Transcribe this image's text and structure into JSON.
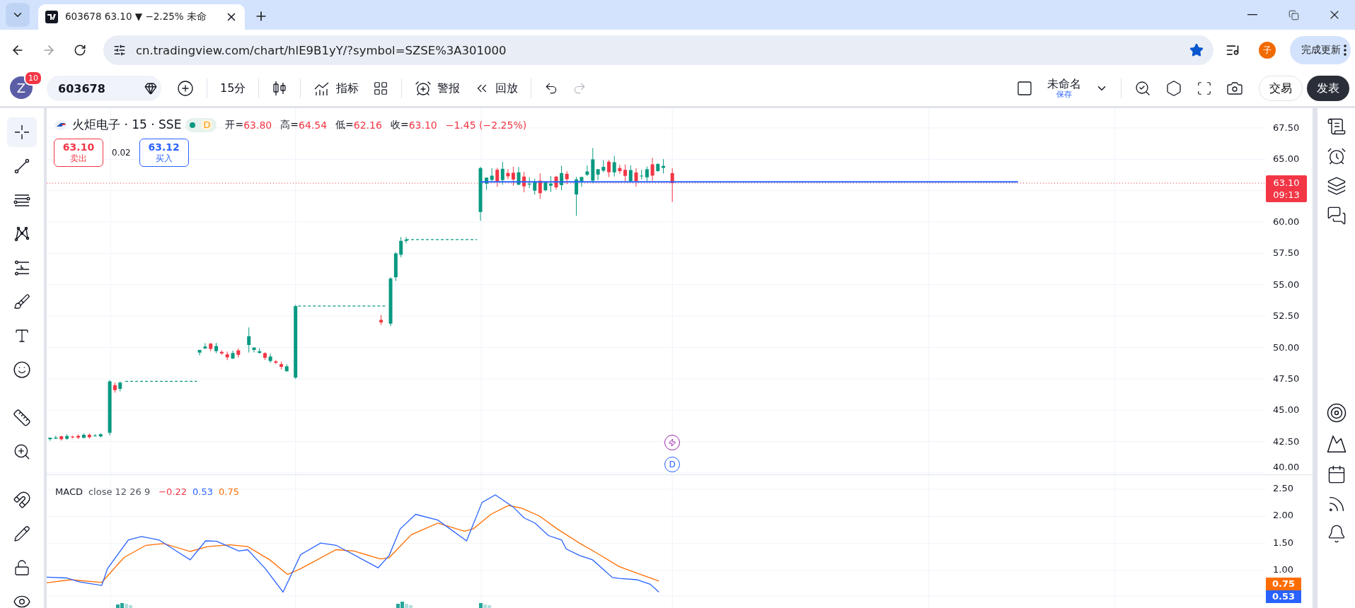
{
  "browser": {
    "tab_title": "603678 63.10 ▼ −2.25% 未命",
    "url": "cn.tradingview.com/chart/hlE9B1yY/?symbol=SZSE%3A301000",
    "profile_initial": "子",
    "update_button": "完成更新"
  },
  "toolbar": {
    "avatar": "Z",
    "notifications": "10",
    "symbol": "603678",
    "interval": "15分",
    "indicators": "指标",
    "alert": "警报",
    "replay": "回放",
    "layout_name": "未命名",
    "save_status": "保存",
    "trade": "交易",
    "publish": "发表"
  },
  "tool_groups": [
    {
      "tools": [
        {
          "kind": "crosshair",
          "selected": true
        },
        {
          "kind": "trend-line",
          "selected": false
        },
        {
          "kind": "fib",
          "selected": false
        },
        {
          "kind": "pattern",
          "selected": false
        },
        {
          "kind": "position",
          "selected": false
        },
        {
          "kind": "brush",
          "selected": false
        },
        {
          "kind": "text",
          "selected": false
        },
        {
          "kind": "smile",
          "selected": false
        }
      ]
    },
    {
      "tools": [
        {
          "kind": "ruler",
          "selected": false
        },
        {
          "kind": "zoom",
          "selected": false
        }
      ]
    },
    {
      "tools": [
        {
          "kind": "magnet",
          "selected": false
        },
        {
          "kind": "pencil-lock",
          "selected": false
        },
        {
          "kind": "lock",
          "selected": false
        },
        {
          "kind": "eye",
          "selected": false
        }
      ]
    }
  ],
  "legend": {
    "name": "火炬电子 · 15 · SSE",
    "status": "D",
    "ohlc": [
      {
        "label": "开=",
        "value": "63.80"
      },
      {
        "label": "高=",
        "value": "64.54"
      },
      {
        "label": "低=",
        "value": "62.16"
      },
      {
        "label": "收=",
        "value": "63.10"
      }
    ],
    "change": "−1.45 (−2.25%)",
    "sell": {
      "price": "63.10",
      "label": "卖出"
    },
    "spread": "0.02",
    "buy": {
      "price": "63.12",
      "label": "买入"
    }
  },
  "price_axis": {
    "ticks": [
      "67.50",
      "65.00",
      "60.00",
      "57.50",
      "55.00",
      "52.50",
      "50.00",
      "47.50",
      "45.00",
      "42.50",
      "40.00"
    ],
    "last_price": "63.10",
    "countdown": "09:13"
  },
  "event_marker": "D",
  "macd": {
    "title": "MACD",
    "params": "close 12 26 9",
    "values": [
      {
        "text": "−0.22",
        "color": "#f23645"
      },
      {
        "text": "0.53",
        "color": "#2962ff"
      },
      {
        "text": "0.75",
        "color": "#ff6d00"
      }
    ],
    "ticks": [
      "2.50",
      "2.00",
      "1.50",
      "1.00"
    ],
    "signal_label": "0.75",
    "macd_label": "0.53"
  }
}
